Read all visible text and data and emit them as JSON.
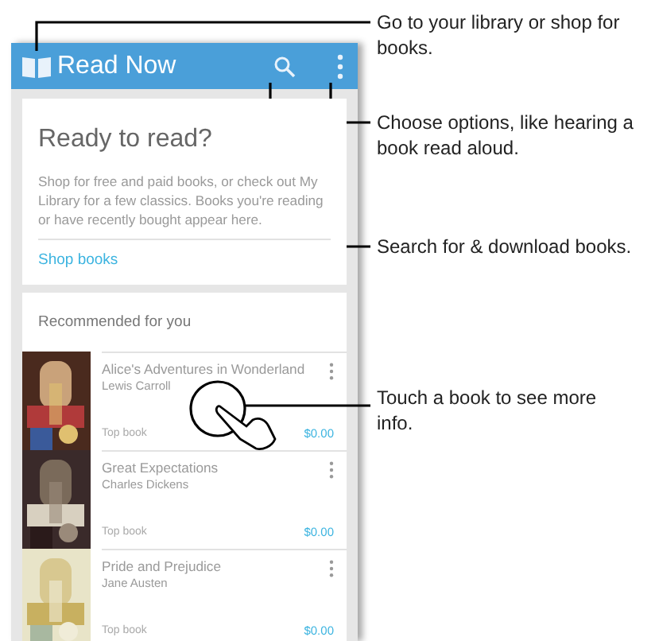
{
  "app_bar": {
    "title": "Read Now"
  },
  "intro_card": {
    "heading": "Ready to read?",
    "body": "Shop for free and paid books, or check out My Library for a few classics. Books you're reading or have recently bought appear here.",
    "link": "Shop books"
  },
  "recommended": {
    "heading": "Recommended for you",
    "books": [
      {
        "title": "Alice's Adventures in Wonderland",
        "author": "Lewis Carroll",
        "tag": "Top book",
        "price": "$0.00"
      },
      {
        "title": "Great Expectations",
        "author": "Charles Dickens",
        "tag": "Top book",
        "price": "$0.00"
      },
      {
        "title": "Pride and Prejudice",
        "author": "Jane Austen",
        "tag": "Top book",
        "price": "$0.00"
      }
    ]
  },
  "callouts": [
    {
      "text": "Go to your library or shop for books."
    },
    {
      "text": "Choose options, like hearing a book read aloud."
    },
    {
      "text": "Search for & download books."
    },
    {
      "text": "Touch a book to see more info."
    }
  ]
}
